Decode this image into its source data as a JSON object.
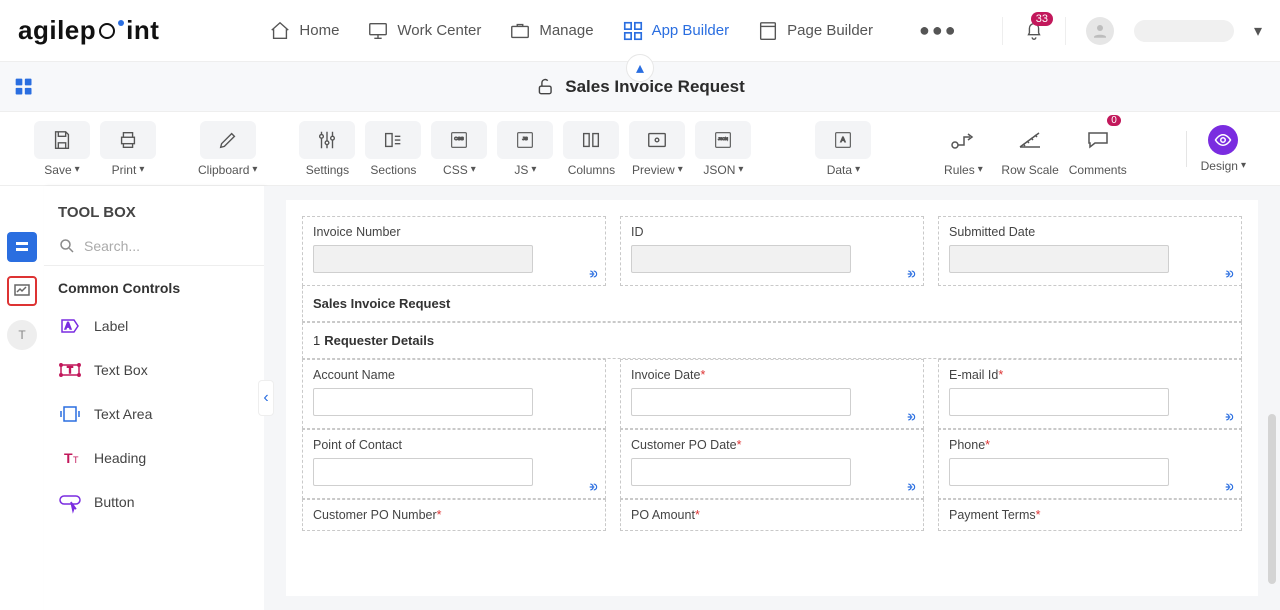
{
  "nav": {
    "items": [
      {
        "label": "Home"
      },
      {
        "label": "Work Center"
      },
      {
        "label": "Manage"
      },
      {
        "label": "App Builder"
      },
      {
        "label": "Page Builder"
      }
    ],
    "notification_count": "33"
  },
  "page": {
    "title": "Sales Invoice Request"
  },
  "toolbar": {
    "save": "Save",
    "print": "Print",
    "clipboard": "Clipboard",
    "settings": "Settings",
    "sections": "Sections",
    "css": "CSS",
    "js": "JS",
    "columns": "Columns",
    "preview": "Preview",
    "json": "JSON",
    "data": "Data",
    "rules": "Rules",
    "rowscale": "Row Scale",
    "comments": "Comments",
    "comments_count": "0",
    "design": "Design"
  },
  "toolbox": {
    "heading": "TOOL BOX",
    "search_placeholder": "Search...",
    "group": "Common Controls",
    "items": [
      {
        "label": "Label"
      },
      {
        "label": "Text Box"
      },
      {
        "label": "Text Area"
      },
      {
        "label": "Heading"
      },
      {
        "label": "Button"
      }
    ]
  },
  "form": {
    "row1": [
      {
        "label": "Invoice Number",
        "disabled": true,
        "link": true
      },
      {
        "label": "ID",
        "disabled": true,
        "link": true
      },
      {
        "label": "Submitted Date",
        "disabled": true,
        "link": true
      }
    ],
    "section_header": "Sales Invoice Request",
    "section1_num": "1",
    "section1_title": "Requester Details",
    "row2": [
      {
        "label": "Account Name",
        "disabled": false,
        "link": false,
        "required": false
      },
      {
        "label": "Invoice Date",
        "disabled": false,
        "link": true,
        "required": true
      },
      {
        "label": "E-mail Id",
        "disabled": false,
        "link": true,
        "required": true
      }
    ],
    "row3": [
      {
        "label": "Point of Contact",
        "disabled": false,
        "link": true,
        "required": false
      },
      {
        "label": "Customer PO Date",
        "disabled": false,
        "link": true,
        "required": true
      },
      {
        "label": "Phone",
        "disabled": false,
        "link": true,
        "required": true
      }
    ],
    "row4": [
      {
        "label": "Customer PO Number",
        "required": true
      },
      {
        "label": "PO Amount",
        "required": true
      },
      {
        "label": "Payment Terms",
        "required": true
      }
    ]
  }
}
